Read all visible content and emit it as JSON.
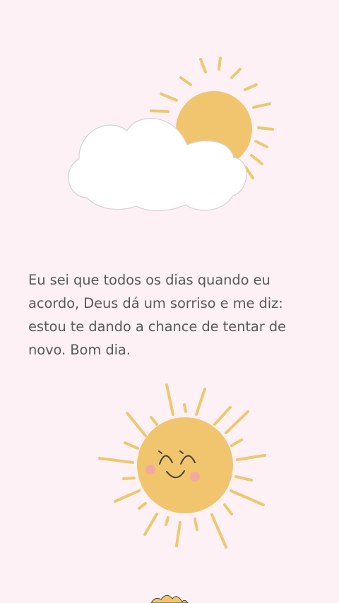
{
  "post": {
    "message": "Eu sei que todos os dias quando eu acordo, Deus dá um sorriso e me diz: estou te dando a chance de tentar de novo. Bom dia."
  },
  "illustrations": {
    "top": "sun-behind-cloud-icon",
    "middle": "smiling-sun-icon",
    "bottom": "flower-icon"
  },
  "colors": {
    "background": "#fdf1f6",
    "sun": "#f0c56d",
    "ray": "#ecc86f",
    "cloud_fill": "#ffffff",
    "cloud_outline": "#d9d3d6",
    "cheek": "#f3a9a0",
    "text": "#5a5a5a"
  }
}
